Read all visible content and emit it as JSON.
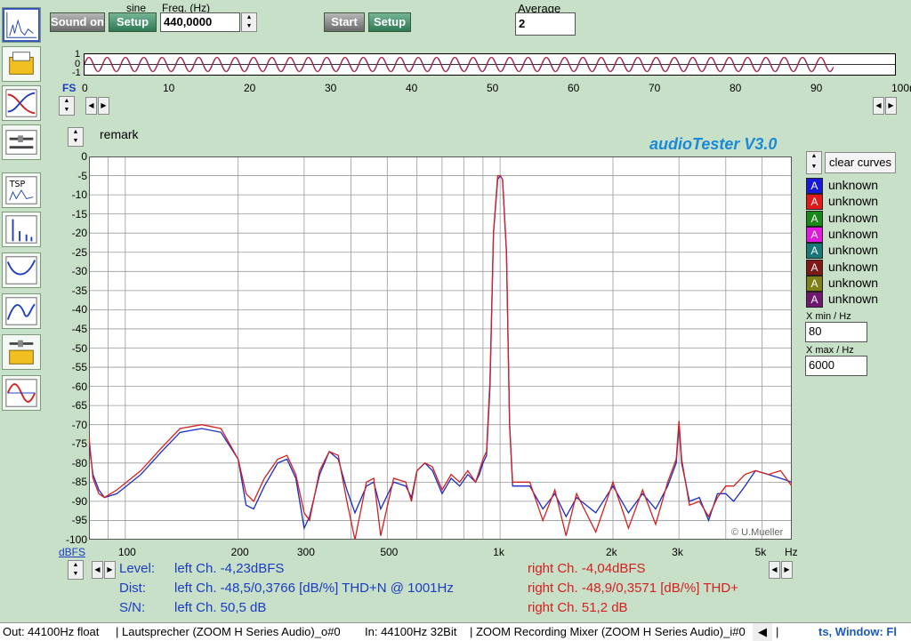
{
  "toolbar": {
    "sound_label": "Sound on",
    "waveform_label": "sine",
    "setup_label": "Setup",
    "freq_label": "Freq. (Hz)",
    "freq_value": "440,0000",
    "start_label": "Start",
    "setup2_label": "Setup",
    "average_label": "Average",
    "average_value": "2"
  },
  "scope": {
    "y_ticks": [
      "1",
      "0",
      "-1"
    ],
    "fs_label": "FS",
    "x_ticks": [
      "0",
      "10",
      "20",
      "30",
      "40",
      "50",
      "60",
      "70",
      "80",
      "90",
      "100ms"
    ],
    "signal_end_ms": 93
  },
  "spectrum": {
    "remark": "remark",
    "brand": "audioTester  V3.0",
    "copyright": "© U.Mueller",
    "y_unit": "dBFS",
    "x_unit": "Hz"
  },
  "legend": {
    "clear_label": "clear curves",
    "items": [
      {
        "letter": "A",
        "label": "unknown",
        "color": "#1818d8"
      },
      {
        "letter": "A",
        "label": "unknown",
        "color": "#e01818"
      },
      {
        "letter": "A",
        "label": "unknown",
        "color": "#188818"
      },
      {
        "letter": "A",
        "label": "unknown",
        "color": "#e018e0"
      },
      {
        "letter": "A",
        "label": "unknown",
        "color": "#187878"
      },
      {
        "letter": "A",
        "label": "unknown",
        "color": "#801818"
      },
      {
        "letter": "A",
        "label": "unknown",
        "color": "#808018"
      },
      {
        "letter": "A",
        "label": "unknown",
        "color": "#701870"
      }
    ],
    "xmin_label": "X min / Hz",
    "xmin_value": "80",
    "xmax_label": "X max / Hz",
    "xmax_value": "6000"
  },
  "results": {
    "level_label": "Level:",
    "dist_label": "Dist:",
    "sn_label": "S/N:",
    "left_level": "left Ch. -4,23dBFS",
    "left_dist": "left Ch. -48,5/0,3766 [dB/%] THD+N  @ 1001Hz",
    "left_sn": "left Ch. 50,5 dB",
    "right_level": "right Ch. -4,04dBFS",
    "right_dist": "right Ch. -48,9/0,3571 [dB/%] THD+",
    "right_sn": "right Ch. 51,2 dB"
  },
  "status": {
    "out": "Out: 44100Hz float",
    "out_dev": "| Lautsprecher (ZOOM H Series Audio)_o#0",
    "in": "In: 44100Hz 32Bit",
    "in_dev": "| ZOOM Recording Mixer (ZOOM H Series Audio)_i#0",
    "extra": "ts, Window: Fl"
  },
  "chart_data": {
    "type": "line",
    "xlabel": "Hz",
    "ylabel": "dBFS",
    "x_scale": "log",
    "xlim": [
      80,
      6000
    ],
    "ylim": [
      -100,
      0
    ],
    "x_ticks": [
      "100",
      "200",
      "300",
      "500",
      "1k",
      "2k",
      "3k",
      "5k"
    ],
    "y_ticks": [
      "0",
      "-5",
      "-10",
      "-15",
      "-20",
      "-25",
      "-30",
      "-35",
      "-40",
      "-45",
      "-50",
      "-55",
      "-60",
      "-65",
      "-70",
      "-75",
      "-80",
      "-85",
      "-90",
      "-95",
      "-100"
    ],
    "grid": true,
    "series": [
      {
        "color": "#1a2cc8",
        "points": [
          [
            80,
            -75
          ],
          [
            82,
            -83
          ],
          [
            85,
            -87
          ],
          [
            88,
            -89
          ],
          [
            95,
            -88
          ],
          [
            110,
            -83
          ],
          [
            125,
            -77
          ],
          [
            140,
            -72
          ],
          [
            160,
            -71
          ],
          [
            180,
            -72
          ],
          [
            200,
            -79
          ],
          [
            210,
            -91
          ],
          [
            220,
            -92
          ],
          [
            235,
            -86
          ],
          [
            255,
            -80
          ],
          [
            270,
            -79
          ],
          [
            285,
            -84
          ],
          [
            300,
            -97
          ],
          [
            310,
            -94
          ],
          [
            330,
            -83
          ],
          [
            350,
            -77
          ],
          [
            370,
            -79
          ],
          [
            390,
            -87
          ],
          [
            410,
            -93
          ],
          [
            440,
            -86
          ],
          [
            460,
            -85
          ],
          [
            480,
            -92
          ],
          [
            520,
            -85
          ],
          [
            560,
            -86
          ],
          [
            580,
            -89
          ],
          [
            600,
            -82
          ],
          [
            630,
            -80
          ],
          [
            660,
            -82
          ],
          [
            700,
            -88
          ],
          [
            740,
            -84
          ],
          [
            780,
            -86
          ],
          [
            820,
            -83
          ],
          [
            860,
            -85
          ],
          [
            880,
            -83
          ],
          [
            900,
            -80
          ],
          [
            920,
            -78
          ],
          [
            940,
            -60
          ],
          [
            960,
            -20
          ],
          [
            985,
            -6
          ],
          [
            1001,
            -5
          ],
          [
            1015,
            -6
          ],
          [
            1040,
            -25
          ],
          [
            1060,
            -70
          ],
          [
            1080,
            -86
          ],
          [
            1200,
            -86
          ],
          [
            1300,
            -92
          ],
          [
            1400,
            -88
          ],
          [
            1500,
            -94
          ],
          [
            1600,
            -89
          ],
          [
            1800,
            -93
          ],
          [
            2000,
            -86
          ],
          [
            2200,
            -93
          ],
          [
            2400,
            -88
          ],
          [
            2600,
            -92
          ],
          [
            2800,
            -86
          ],
          [
            2950,
            -80
          ],
          [
            3000,
            -70
          ],
          [
            3050,
            -80
          ],
          [
            3200,
            -90
          ],
          [
            3400,
            -89
          ],
          [
            3600,
            -95
          ],
          [
            3800,
            -88
          ],
          [
            4000,
            -88
          ],
          [
            4200,
            -90
          ],
          [
            4500,
            -86
          ],
          [
            4800,
            -82
          ],
          [
            5200,
            -83
          ],
          [
            5600,
            -84
          ],
          [
            6000,
            -85
          ]
        ]
      },
      {
        "color": "#d42020",
        "points": [
          [
            80,
            -73
          ],
          [
            82,
            -84
          ],
          [
            85,
            -88
          ],
          [
            88,
            -89
          ],
          [
            95,
            -87
          ],
          [
            110,
            -82
          ],
          [
            125,
            -76
          ],
          [
            140,
            -71
          ],
          [
            160,
            -70
          ],
          [
            180,
            -71
          ],
          [
            200,
            -79
          ],
          [
            210,
            -88
          ],
          [
            220,
            -90
          ],
          [
            235,
            -84
          ],
          [
            255,
            -79
          ],
          [
            270,
            -78
          ],
          [
            285,
            -83
          ],
          [
            300,
            -93
          ],
          [
            310,
            -95
          ],
          [
            330,
            -82
          ],
          [
            350,
            -77
          ],
          [
            370,
            -78
          ],
          [
            390,
            -90
          ],
          [
            410,
            -100
          ],
          [
            440,
            -85
          ],
          [
            460,
            -84
          ],
          [
            480,
            -99
          ],
          [
            520,
            -84
          ],
          [
            560,
            -85
          ],
          [
            580,
            -90
          ],
          [
            600,
            -82
          ],
          [
            630,
            -80
          ],
          [
            660,
            -81
          ],
          [
            700,
            -87
          ],
          [
            740,
            -83
          ],
          [
            780,
            -85
          ],
          [
            820,
            -82
          ],
          [
            860,
            -85
          ],
          [
            880,
            -82
          ],
          [
            900,
            -79
          ],
          [
            920,
            -77
          ],
          [
            940,
            -58
          ],
          [
            960,
            -20
          ],
          [
            985,
            -5
          ],
          [
            1001,
            -5
          ],
          [
            1015,
            -6
          ],
          [
            1040,
            -25
          ],
          [
            1060,
            -70
          ],
          [
            1080,
            -85
          ],
          [
            1200,
            -85
          ],
          [
            1300,
            -95
          ],
          [
            1400,
            -87
          ],
          [
            1500,
            -99
          ],
          [
            1600,
            -88
          ],
          [
            1800,
            -98
          ],
          [
            2000,
            -85
          ],
          [
            2200,
            -97
          ],
          [
            2400,
            -87
          ],
          [
            2600,
            -96
          ],
          [
            2800,
            -85
          ],
          [
            2950,
            -79
          ],
          [
            3000,
            -69
          ],
          [
            3050,
            -79
          ],
          [
            3200,
            -91
          ],
          [
            3400,
            -90
          ],
          [
            3600,
            -94
          ],
          [
            3800,
            -89
          ],
          [
            4000,
            -86
          ],
          [
            4200,
            -86
          ],
          [
            4500,
            -83
          ],
          [
            4800,
            -82
          ],
          [
            5200,
            -83
          ],
          [
            5600,
            -82
          ],
          [
            6000,
            -86
          ]
        ]
      }
    ]
  }
}
